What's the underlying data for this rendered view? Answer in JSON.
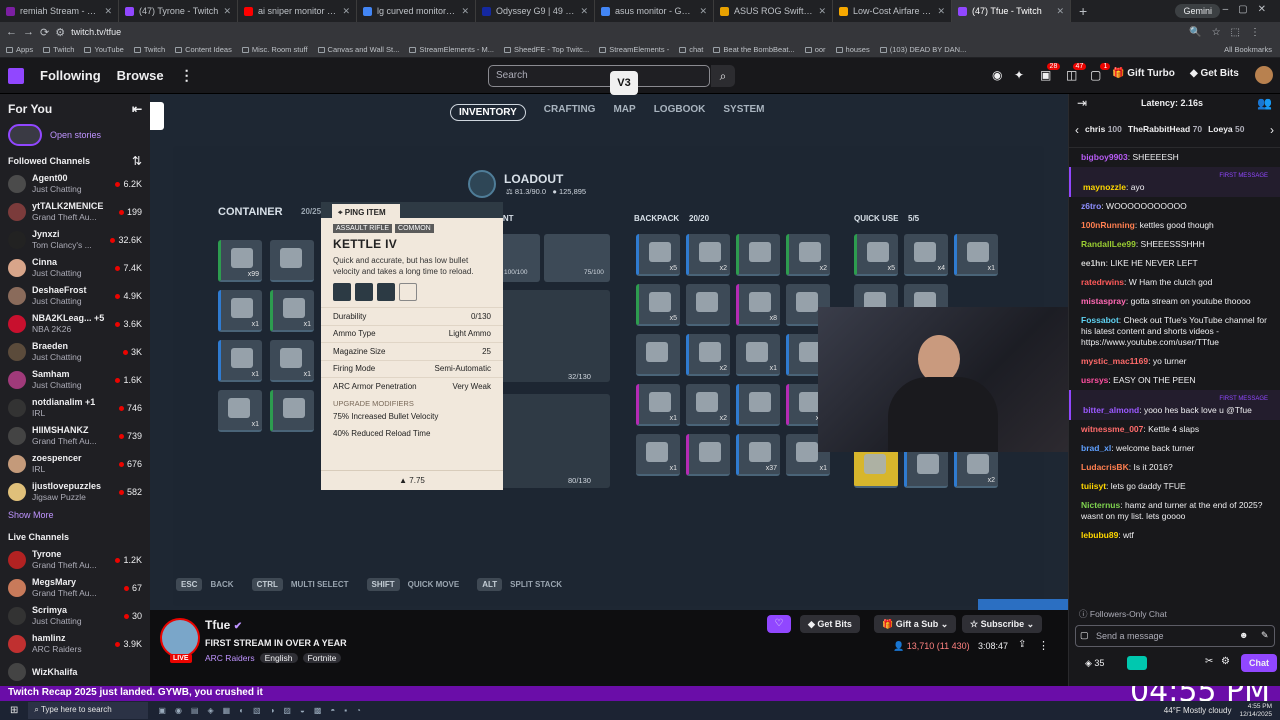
{
  "browser": {
    "tabs": [
      {
        "title": "remiah Stream - Watch Live on",
        "color": "#7b1fa2"
      },
      {
        "title": "(47) Tyrone - Twitch",
        "color": "#9147ff"
      },
      {
        "title": "ai sniper monitor - YouTube",
        "color": "#ff0000"
      },
      {
        "title": "lg curved monitor - Google Se",
        "color": "#4285f4"
      },
      {
        "title": "Odyssey G9 | 49 inch G95C DQ",
        "color": "#1428a0"
      },
      {
        "title": "asus monitor - Google Search",
        "color": "#4285f4"
      },
      {
        "title": "ASUS ROG Swift 32\" Dual Mod",
        "color": "#e8a100"
      },
      {
        "title": "Low-Cost Airfare the Way You",
        "color": "#f6a800"
      },
      {
        "title": "(47) Tfue - Twitch",
        "color": "#9147ff"
      }
    ],
    "new_tab": "+",
    "gemini": "Gemini",
    "url": "twitch.tv/tfue",
    "bookmarks": [
      "Apps",
      "Twitch",
      "YouTube",
      "Twitch",
      "Content Ideas",
      "Misc. Room stuff",
      "Canvas and Wall St...",
      "StreamElements - M...",
      "SheedFE - Top Twitc...",
      "StreamElements -",
      "chat",
      "Beat the BombBeat...",
      "oor",
      "houses",
      "(103) DEAD BY DAN..."
    ],
    "all_bookmarks": "All Bookmarks"
  },
  "twitch_nav": {
    "following": "Following",
    "browse": "Browse",
    "search_placeholder": "Search",
    "notif1": "28",
    "notif2": "47",
    "notif3": "1",
    "gift_turbo": "Gift Turbo",
    "get_bits": "Get Bits"
  },
  "overlay_badge": "V3",
  "sidebar": {
    "for_you": "For You",
    "open_stories": "Open stories",
    "followed_title": "Followed Channels",
    "followed": [
      {
        "name": "Agent00",
        "cat": "Just Chatting",
        "viewers": "6.2K",
        "color": "#4b4b4b"
      },
      {
        "name": "ytTALK2MENICE",
        "cat": "Grand Theft Au...",
        "viewers": "199",
        "color": "#7b3b3b"
      },
      {
        "name": "Jynxzi",
        "cat": "Tom Clancy's ...",
        "viewers": "32.6K",
        "color": "#222"
      },
      {
        "name": "Cinna",
        "cat": "Just Chatting",
        "viewers": "7.4K",
        "color": "#d8a58a"
      },
      {
        "name": "DeshaeFrost",
        "cat": "Just Chatting",
        "viewers": "4.9K",
        "color": "#8a6b5b"
      },
      {
        "name": "NBA2KLeag... +5",
        "cat": "NBA 2K26",
        "viewers": "3.6K",
        "color": "#c8102e"
      },
      {
        "name": "Braeden",
        "cat": "Just Chatting",
        "viewers": "3K",
        "color": "#5b4b3b"
      },
      {
        "name": "Samham",
        "cat": "Just Chatting",
        "viewers": "1.6K",
        "color": "#a03a7a"
      },
      {
        "name": "notdianalim +1",
        "cat": "IRL",
        "viewers": "746",
        "color": "#333"
      },
      {
        "name": "HIIMSHANKZ",
        "cat": "Grand Theft Au...",
        "viewers": "739",
        "color": "#444"
      },
      {
        "name": "zoespencer",
        "cat": "IRL",
        "viewers": "676",
        "color": "#c49a7a"
      },
      {
        "name": "ijustlovepuzzles",
        "cat": "Jigsaw Puzzle",
        "viewers": "582",
        "color": "#e0c07a"
      }
    ],
    "show_more": "Show More",
    "live_title": "Live Channels",
    "live": [
      {
        "name": "Tyrone",
        "cat": "Grand Theft Au...",
        "viewers": "1.2K",
        "color": "#b22222"
      },
      {
        "name": "MegsMary",
        "cat": "Grand Theft Au...",
        "viewers": "67",
        "color": "#c87a5a"
      },
      {
        "name": "Scrimya",
        "cat": "Just Chatting",
        "viewers": "30",
        "color": "#333"
      },
      {
        "name": "hamlinz",
        "cat": "ARC Raiders",
        "viewers": "3.9K",
        "color": "#c03030"
      },
      {
        "name": "WizKhalifa",
        "cat": "",
        "viewers": "",
        "color": "#444"
      }
    ]
  },
  "game": {
    "tabs": [
      "INVENTORY",
      "CRAFTING",
      "MAP",
      "LOGBOOK",
      "SYSTEM"
    ],
    "loadout_title": "LOADOUT",
    "loadout_weight": "81.3/90.0",
    "loadout_coins": "125,895",
    "container_title": "CONTAINER",
    "container_count": "20/25",
    "equipment_title": "EQUIPMENT",
    "backpack_title": "BACKPACK",
    "backpack_count": "20/20",
    "quickuse_title": "QUICK USE",
    "quickuse_count": "5/5",
    "durability_1": "100/100",
    "durability_2": "75/100",
    "ammo_1": "32/130",
    "ammo_2": "80/130",
    "ping": "PING ITEM",
    "tooltip": {
      "type": "ASSAULT RIFLE",
      "rarity": "COMMON",
      "name": "KETTLE IV",
      "desc": "Quick and accurate, but has low bullet velocity and takes a long time to reload.",
      "stats": [
        {
          "label": "Durability",
          "value": "0/130"
        },
        {
          "label": "Ammo Type",
          "value": "Light Ammo"
        },
        {
          "label": "Magazine Size",
          "value": "25"
        },
        {
          "label": "Firing Mode",
          "value": "Semi-Automatic"
        },
        {
          "label": "ARC Armor Penetration",
          "value": "Very Weak"
        }
      ],
      "upgrade_title": "UPGRADE MODIFIERS",
      "upgrades": [
        "75% Increased Bullet Velocity",
        "40% Reduced Reload Time"
      ],
      "weight": "7.75"
    },
    "keys": [
      {
        "key": "ESC",
        "label": "BACK"
      },
      {
        "key": "CTRL",
        "label": "MULTI SELECT"
      },
      {
        "key": "SHIFT",
        "label": "QUICK MOVE"
      },
      {
        "key": "ALT",
        "label": "SPLIT STACK"
      }
    ],
    "container_counts": [
      "x99",
      "x1",
      "x1",
      "x1",
      "x1",
      "x1"
    ],
    "backpack_counts": [
      "x5",
      "x2",
      "x2",
      "x5",
      "x8",
      "x1",
      "x2",
      "x1",
      "x1",
      "x2",
      "x17",
      "x1",
      "x37",
      "x1"
    ],
    "quick_counts": [
      "x5",
      "x4",
      "x1",
      "x2"
    ]
  },
  "stream": {
    "channel": "Tfue",
    "title": "FIRST STREAM IN OVER A YEAR",
    "game": "ARC Raiders",
    "tags": [
      "English",
      "Fortnite"
    ],
    "live": "LIVE",
    "get_bits": "Get Bits",
    "gift_sub": "Gift a Sub",
    "subscribe": "Subscribe",
    "viewers": "13,710 (11 430)",
    "uptime": "3:08:47"
  },
  "chat": {
    "latency": "Latency: 2.16s",
    "leaders": [
      {
        "name": "chris",
        "count": "100"
      },
      {
        "name": "TheRabbitHead",
        "count": "70"
      },
      {
        "name": "Loeya",
        "count": "50"
      }
    ],
    "first_label": "FIRST MESSAGE",
    "messages": [
      {
        "user": "bigboy9903",
        "text": "SHEEEESH",
        "color": "#b85cf5",
        "first": false
      },
      {
        "user": "maynozzle",
        "text": "ayo",
        "color": "#ffd700",
        "first": true
      },
      {
        "user": "z6tro",
        "text": "WOOOOOOOOOOO",
        "color": "#8f8fff",
        "first": false
      },
      {
        "user": "100nRunning",
        "text": "kettles good though",
        "color": "#ff7f50",
        "first": false
      },
      {
        "user": "RandallLee99",
        "text": "SHEEESSSHHH",
        "color": "#9acd32",
        "first": false
      },
      {
        "user": "ee1hn",
        "text": "LIKE HE NEVER LEFT",
        "color": "#cfcfcf",
        "first": false
      },
      {
        "user": "ratedrwins",
        "text": "W Ham the clutch god",
        "color": "#ff5a5a",
        "first": false
      },
      {
        "user": "mistaspray",
        "text": "gotta stream on youtube thoooo",
        "color": "#ff69b4",
        "first": false
      },
      {
        "user": "Fossabot",
        "text": "Check out Tfue's YouTube channel for his latest content and shorts videos - https://www.youtube.com/user/TTfue",
        "color": "#5fd3f3",
        "first": false
      },
      {
        "user": "mystic_mac1169",
        "text": "yo turner",
        "color": "#ff6a6a",
        "first": false
      },
      {
        "user": "usrsys",
        "text": "EASY ON THE PEEN",
        "color": "#ff4fa0",
        "first": false
      },
      {
        "user": "bitter_almond",
        "text": "yooo hes back love u @Tfue",
        "color": "#9b59ff",
        "first": true
      },
      {
        "user": "witnessme_007",
        "text": "Kettle 4 slaps",
        "color": "#ff6b6b",
        "first": false
      },
      {
        "user": "brad_xl",
        "text": "welcome back turner",
        "color": "#5fa0ff",
        "first": false
      },
      {
        "user": "LudacrisBK",
        "text": "Is it 2016?",
        "color": "#ff7f50",
        "first": false
      },
      {
        "user": "tuiisyt",
        "text": "lets go daddy TFUE",
        "color": "#ffd700",
        "first": false
      },
      {
        "user": "Nicternus",
        "text": "hamz and turner at the end of 2025? wasnt on my list. lets goooo",
        "color": "#7fd34f",
        "first": false
      },
      {
        "user": "lebubu89",
        "text": "wtf",
        "color": "#ffd700",
        "first": false
      }
    ],
    "followers_only": "Followers-Only Chat",
    "send_placeholder": "Send a message",
    "points": "35",
    "chat_btn": "Chat"
  },
  "banner_text": "Twitch Recap 2025 just landed. GYWB, you crushed it",
  "clock_overlay": "04:55 PM",
  "taskbar": {
    "search": "Type here to search",
    "weather": "44°F  Mostly cloudy",
    "time": "4:55 PM",
    "date": "12/14/2025"
  }
}
